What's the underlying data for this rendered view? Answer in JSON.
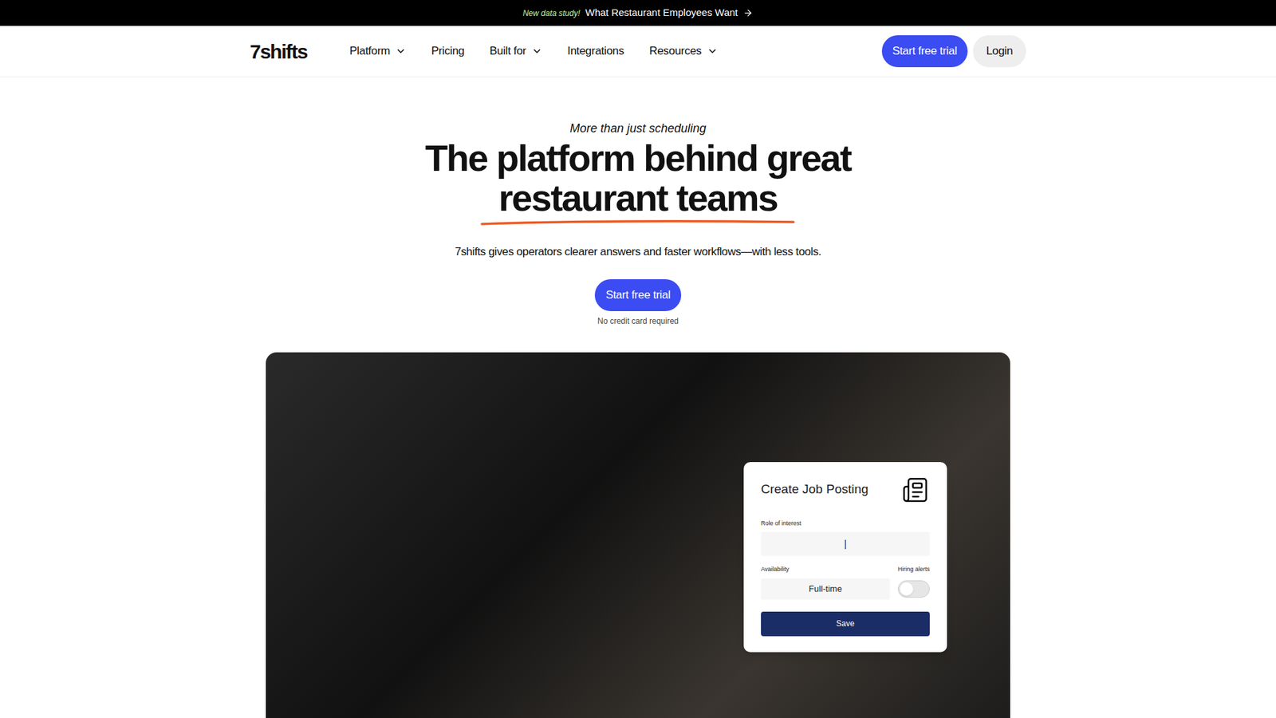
{
  "banner": {
    "tag": "New data study!",
    "text": "What Restaurant Employees Want"
  },
  "logo": "7shifts",
  "nav": [
    {
      "label": "Platform",
      "dropdown": true
    },
    {
      "label": "Pricing",
      "dropdown": false
    },
    {
      "label": "Built for",
      "dropdown": true
    },
    {
      "label": "Integrations",
      "dropdown": false
    },
    {
      "label": "Resources",
      "dropdown": true
    }
  ],
  "header_buttons": {
    "primary": "Start free trial",
    "secondary": "Login"
  },
  "hero": {
    "eyebrow": "More than just scheduling",
    "title_lines": [
      "The platform behind great",
      "restaurant teams"
    ],
    "subtitle": "7shifts gives operators clearer answers and faster workflows—with less tools.",
    "cta": "Start free trial",
    "note": "No credit card required"
  },
  "job_card": {
    "title": "Create Job Posting",
    "role_label": "Role of interest",
    "role_value": "|",
    "availability_label": "Availability",
    "availability_value": "Full-time",
    "alerts_label": "Hiring alerts",
    "alerts_on": false,
    "save": "Save"
  }
}
